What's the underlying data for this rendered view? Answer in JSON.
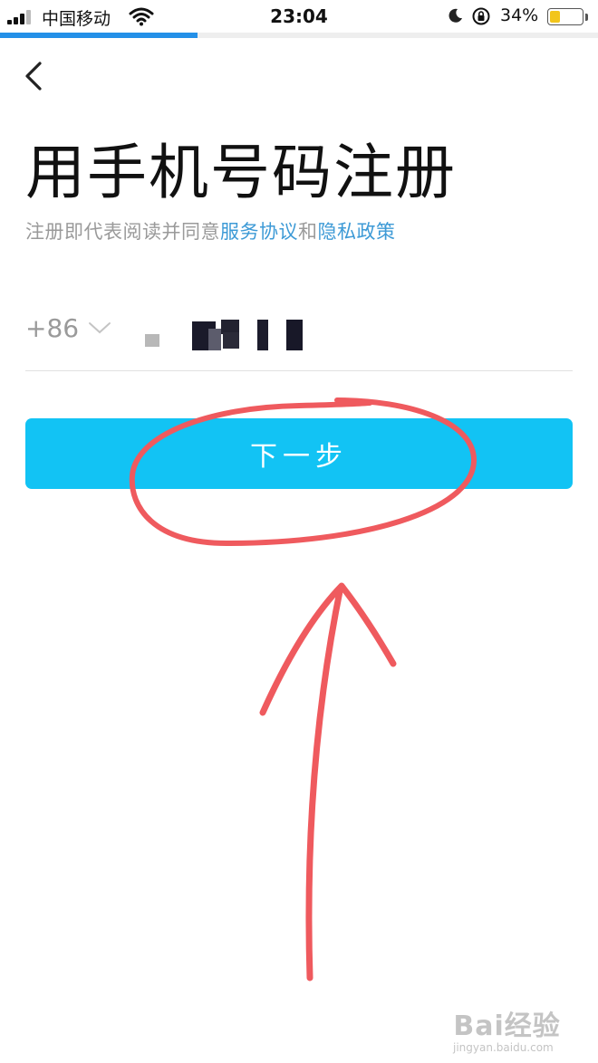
{
  "status_bar": {
    "carrier": "中国移动",
    "time": "23:04",
    "battery_text": "34%",
    "battery_level": 0.34,
    "icons": [
      "signal-icon",
      "wifi-icon",
      "moon-icon",
      "orientation-lock-icon",
      "battery-icon"
    ]
  },
  "load_progress": 0.33,
  "header": {
    "back_icon": "chevron-left-icon"
  },
  "page": {
    "title": "用手机号码注册",
    "agreement_prefix": "注册即代表阅读并同意",
    "terms_link": "服务协议",
    "agreement_joiner": "和",
    "privacy_link": "隐私政策"
  },
  "phone": {
    "country_code": "+86",
    "dropdown_icon": "chevron-down-icon"
  },
  "next_button": {
    "label": "下一步"
  },
  "watermark": {
    "brand": "Bai经验",
    "url": "jingyan.baidu.com"
  },
  "colors": {
    "primary_button": "#12c3f4",
    "link": "#3d9ad6",
    "progress": "#2490e8",
    "annotation": "#ef5a5e",
    "battery": "#f2c51b"
  }
}
